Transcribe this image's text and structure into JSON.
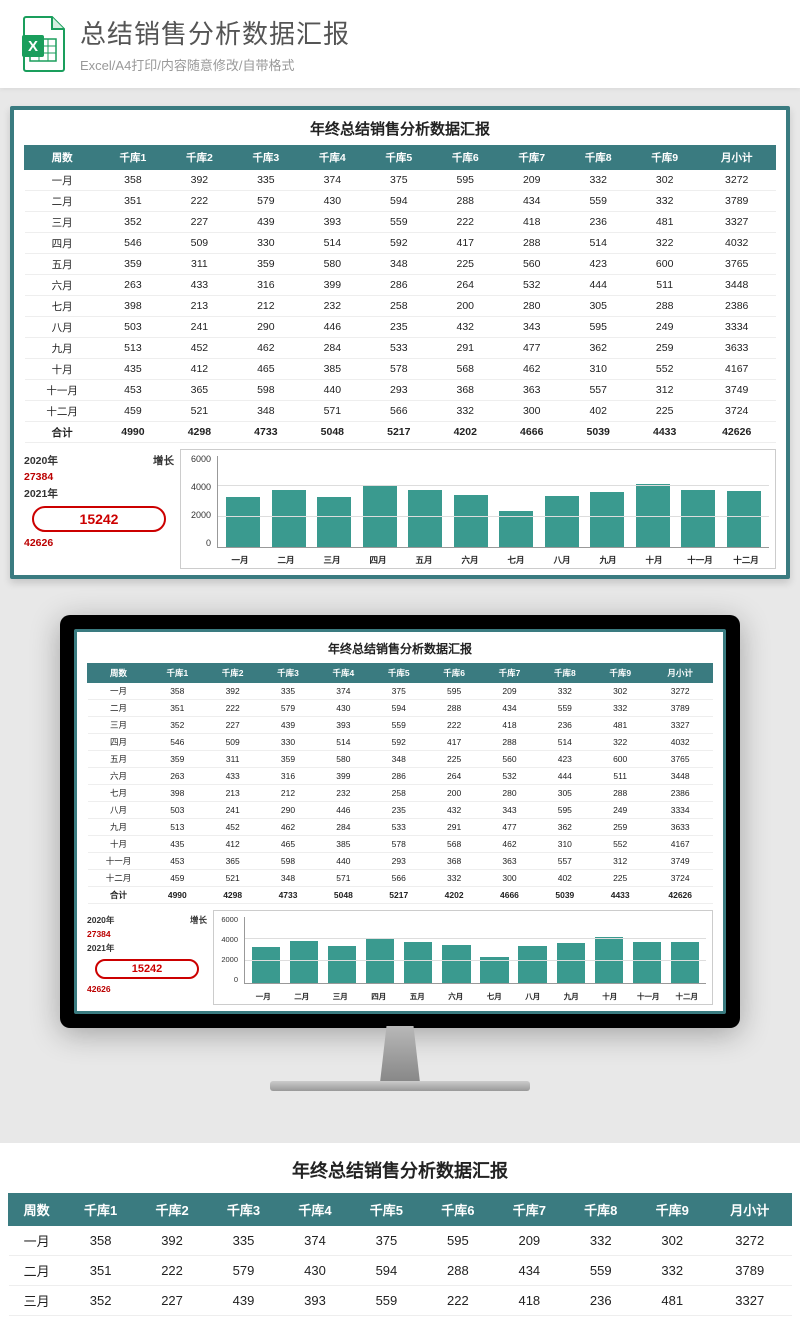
{
  "header": {
    "title": "总结销售分析数据汇报",
    "sub": "Excel/A4打印/内容随意修改/自带格式"
  },
  "report_title": "年终总结销售分析数据汇报",
  "columns": [
    "周数",
    "千库1",
    "千库2",
    "千库3",
    "千库4",
    "千库5",
    "千库6",
    "千库7",
    "千库8",
    "千库9",
    "月小计"
  ],
  "rows": [
    {
      "m": "一月",
      "d": [
        358,
        392,
        335,
        374,
        375,
        595,
        209,
        332,
        302,
        3272
      ]
    },
    {
      "m": "二月",
      "d": [
        351,
        222,
        579,
        430,
        594,
        288,
        434,
        559,
        332,
        3789
      ]
    },
    {
      "m": "三月",
      "d": [
        352,
        227,
        439,
        393,
        559,
        222,
        418,
        236,
        481,
        3327
      ]
    },
    {
      "m": "四月",
      "d": [
        546,
        509,
        330,
        514,
        592,
        417,
        288,
        514,
        322,
        4032
      ]
    },
    {
      "m": "五月",
      "d": [
        359,
        311,
        359,
        580,
        348,
        225,
        560,
        423,
        600,
        3765
      ]
    },
    {
      "m": "六月",
      "d": [
        263,
        433,
        316,
        399,
        286,
        264,
        532,
        444,
        511,
        3448
      ]
    },
    {
      "m": "七月",
      "d": [
        398,
        213,
        212,
        232,
        258,
        200,
        280,
        305,
        288,
        2386
      ]
    },
    {
      "m": "八月",
      "d": [
        503,
        241,
        290,
        446,
        235,
        432,
        343,
        595,
        249,
        3334
      ]
    },
    {
      "m": "九月",
      "d": [
        513,
        452,
        462,
        284,
        533,
        291,
        477,
        362,
        259,
        3633
      ]
    },
    {
      "m": "十月",
      "d": [
        435,
        412,
        465,
        385,
        578,
        568,
        462,
        310,
        552,
        4167
      ]
    },
    {
      "m": "十一月",
      "d": [
        453,
        365,
        598,
        440,
        293,
        368,
        363,
        557,
        312,
        3749
      ]
    },
    {
      "m": "十二月",
      "d": [
        459,
        521,
        348,
        571,
        566,
        332,
        300,
        402,
        225,
        3724
      ]
    }
  ],
  "total_row": {
    "m": "合计",
    "d": [
      4990,
      4298,
      4733,
      5048,
      5217,
      4202,
      4666,
      5039,
      4433,
      42626
    ]
  },
  "summary": {
    "y1_label": "2020年",
    "y1_val": "27384",
    "growth_label": "增长",
    "growth_val": "15242",
    "y2_label": "2021年",
    "y2_val": "42626"
  },
  "chart_data": {
    "type": "bar",
    "title": "",
    "categories": [
      "一月",
      "二月",
      "三月",
      "四月",
      "五月",
      "六月",
      "七月",
      "八月",
      "九月",
      "十月",
      "十一月",
      "十二月"
    ],
    "values": [
      3272,
      3789,
      3327,
      4032,
      3765,
      3448,
      2386,
      3334,
      3633,
      4167,
      3749,
      3724
    ],
    "ylim": [
      0,
      6000
    ],
    "yticks": [
      0,
      2000,
      4000,
      6000
    ],
    "xlabel": "",
    "ylabel": ""
  }
}
